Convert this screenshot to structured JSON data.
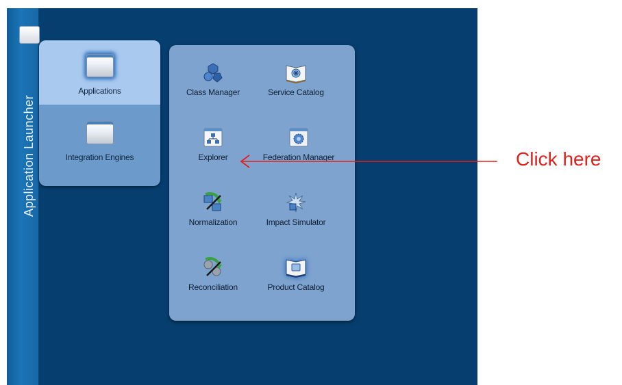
{
  "launcher": {
    "title": "Application Launcher"
  },
  "categories": [
    {
      "label": "Applications",
      "icon": "window-icon",
      "selected": true
    },
    {
      "label": "Integration Engines",
      "icon": "window-icon",
      "selected": false
    }
  ],
  "apps": [
    {
      "label": "Class Manager",
      "icon": "class-manager-icon"
    },
    {
      "label": "Service Catalog",
      "icon": "service-catalog-icon"
    },
    {
      "label": "Explorer",
      "icon": "explorer-icon"
    },
    {
      "label": "Federation Manager",
      "icon": "federation-manager-icon"
    },
    {
      "label": "Normalization",
      "icon": "normalization-icon"
    },
    {
      "label": "Impact Simulator",
      "icon": "impact-simulator-icon"
    },
    {
      "label": "Reconciliation",
      "icon": "reconciliation-icon"
    },
    {
      "label": "Product Catalog",
      "icon": "product-catalog-icon"
    }
  ],
  "annotation": {
    "text": "Click here",
    "color": "#e0211d"
  },
  "colors": {
    "background": "#063f6f",
    "launcher_strip": "#1b75b7",
    "panel": "#7ea3cf",
    "selected": "#a9caee"
  }
}
